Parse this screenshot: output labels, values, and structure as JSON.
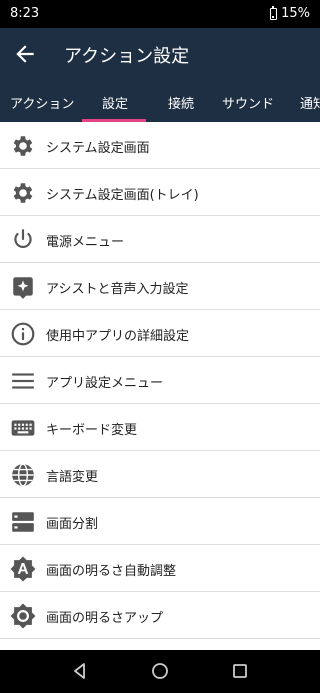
{
  "status": {
    "time": "8:23",
    "battery": "15%"
  },
  "appbar": {
    "title": "アクション設定"
  },
  "tabs": [
    {
      "label": "アクション"
    },
    {
      "label": "設定"
    },
    {
      "label": "接続"
    },
    {
      "label": "サウンド"
    },
    {
      "label": "通知"
    }
  ],
  "active_tab": 1,
  "list": [
    {
      "label": "システム設定画面",
      "icon": "gear-icon"
    },
    {
      "label": "システム設定画面(トレイ)",
      "icon": "gear-icon"
    },
    {
      "label": "電源メニュー",
      "icon": "power-icon"
    },
    {
      "label": "アシストと音声入力設定",
      "icon": "assistant-icon"
    },
    {
      "label": "使用中アプリの詳細設定",
      "icon": "info-icon"
    },
    {
      "label": "アプリ設定メニュー",
      "icon": "menu-icon"
    },
    {
      "label": "キーボード変更",
      "icon": "keyboard-icon"
    },
    {
      "label": "言語変更",
      "icon": "globe-icon"
    },
    {
      "label": "画面分割",
      "icon": "split-screen-icon"
    },
    {
      "label": "画面の明るさ自動調整",
      "icon": "brightness-auto-icon"
    },
    {
      "label": "画面の明るさアップ",
      "icon": "brightness-up-icon"
    }
  ],
  "colors": {
    "appbar": "#1f2f43",
    "tab_indicator": "#e44483",
    "icon": "#555555"
  }
}
